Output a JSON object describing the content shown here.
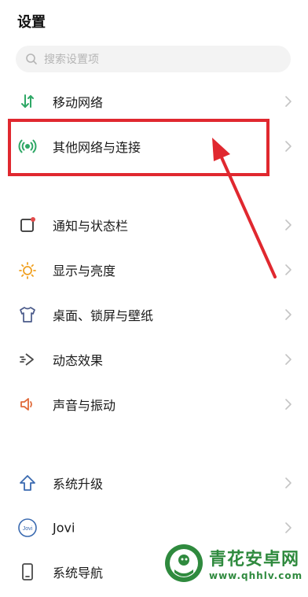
{
  "header": {
    "title": "设置"
  },
  "search": {
    "placeholder": "搜索设置项",
    "icon": "search-icon"
  },
  "groups": [
    {
      "items": [
        {
          "label": "移动网络",
          "icon": "mobile-data-icon",
          "color": "#2fa866"
        },
        {
          "label": "其他网络与连接",
          "icon": "wireless-connection-icon",
          "color": "#2fa866"
        }
      ]
    },
    {
      "items": [
        {
          "label": "通知与状态栏",
          "icon": "notification-icon",
          "color": "#e24a4a"
        },
        {
          "label": "显示与亮度",
          "icon": "brightness-icon",
          "color": "#f0a020"
        },
        {
          "label": "桌面、锁屏与壁纸",
          "icon": "wallpaper-shirt-icon",
          "color": "#4a5a8a"
        },
        {
          "label": "动态效果",
          "icon": "animation-effect-icon",
          "color": "#4a4a4a"
        },
        {
          "label": "声音与振动",
          "icon": "speaker-icon",
          "color": "#e06a3a"
        }
      ]
    },
    {
      "items": [
        {
          "label": "系统升级",
          "icon": "upgrade-arrow-icon",
          "color": "#3a6ab0"
        },
        {
          "label": "Jovi",
          "icon": "jovi-icon",
          "color": "#3a6ab0"
        },
        {
          "label": "系统导航",
          "icon": "phone-navigation-icon",
          "color": "#4a4a4a"
        }
      ]
    }
  ],
  "annotation": {
    "highlight_color": "#e0282f"
  },
  "watermark": {
    "name": "青花安卓网",
    "url": "www.qhhlv.com",
    "color": "#2f8a3e"
  }
}
